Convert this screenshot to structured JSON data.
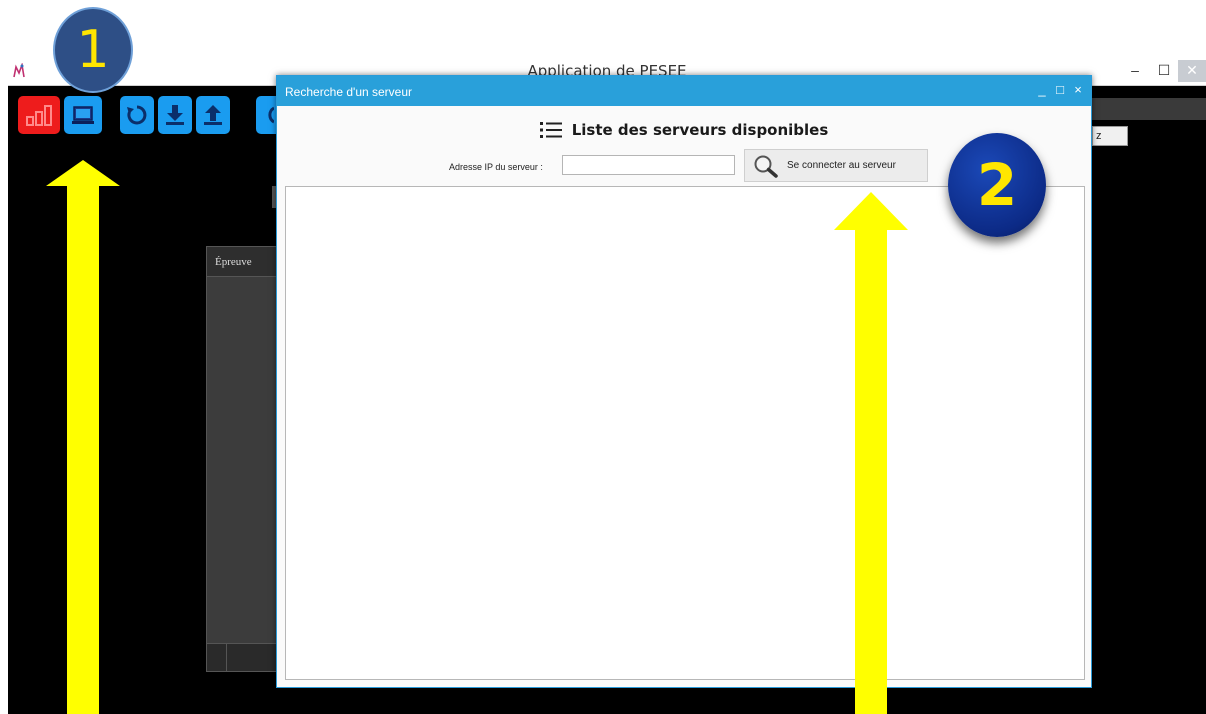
{
  "main_window": {
    "title": "Application de PESEE",
    "controls": {
      "minimize": "–",
      "maximize": "☐",
      "close": "✕"
    },
    "right_field_text": "z",
    "background_panel": {
      "column_header": "Épreuve"
    },
    "toolbar": [
      "stats-icon",
      "server-icon",
      "refresh-icon",
      "download-icon",
      "upload-icon"
    ]
  },
  "dialog": {
    "title": "Recherche d'un serveur",
    "controls": {
      "minimize": "_",
      "maximize": "□",
      "close": "×"
    },
    "list_title": "Liste des serveurs disponibles",
    "ip_label": "Adresse IP du serveur :",
    "ip_value": "",
    "connect_button": "Se connecter au serveur",
    "servers": []
  },
  "annotations": {
    "badge_1": "1",
    "badge_2": "2",
    "arrow_color": "#ffff00"
  },
  "colors": {
    "accent_blue": "#1a9cf0",
    "stats_red": "#ee1c1c",
    "dialog_title_blue": "#29a0da"
  }
}
